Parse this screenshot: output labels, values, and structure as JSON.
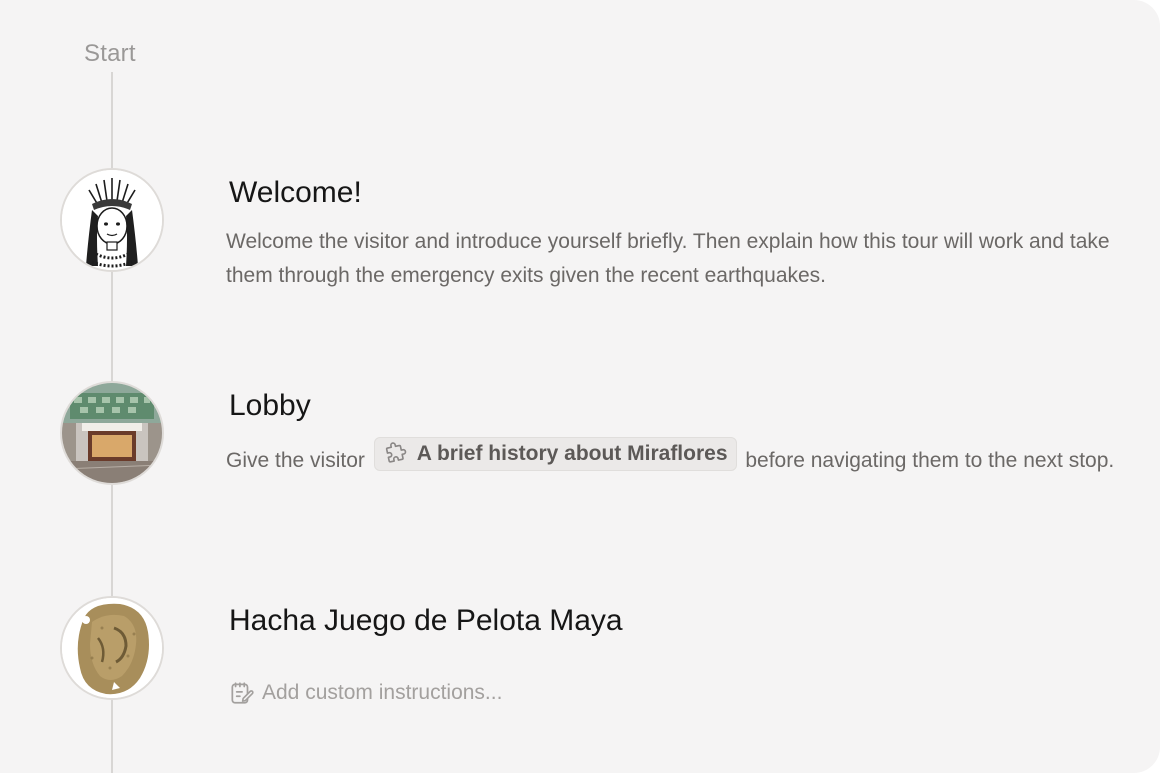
{
  "timeline": {
    "start_label": "Start"
  },
  "steps": [
    {
      "title": "Welcome!",
      "description": "Welcome the visitor and introduce yourself briefly. Then explain how this tour will work and take them through the emergency exits given the recent earthquakes.",
      "avatar": "guide-illustration"
    },
    {
      "title": "Lobby",
      "description_before": "Give the visitor",
      "chip_label": "A brief history about Miraflores",
      "chip_icon": "puzzle-icon",
      "description_after": "before navigating them to the next stop.",
      "avatar": "lobby-photo"
    },
    {
      "title": "Hacha Juego de Pelota Maya",
      "placeholder": "Add custom instructions...",
      "placeholder_icon": "note-edit-icon",
      "avatar": "artifact-photo"
    }
  ]
}
